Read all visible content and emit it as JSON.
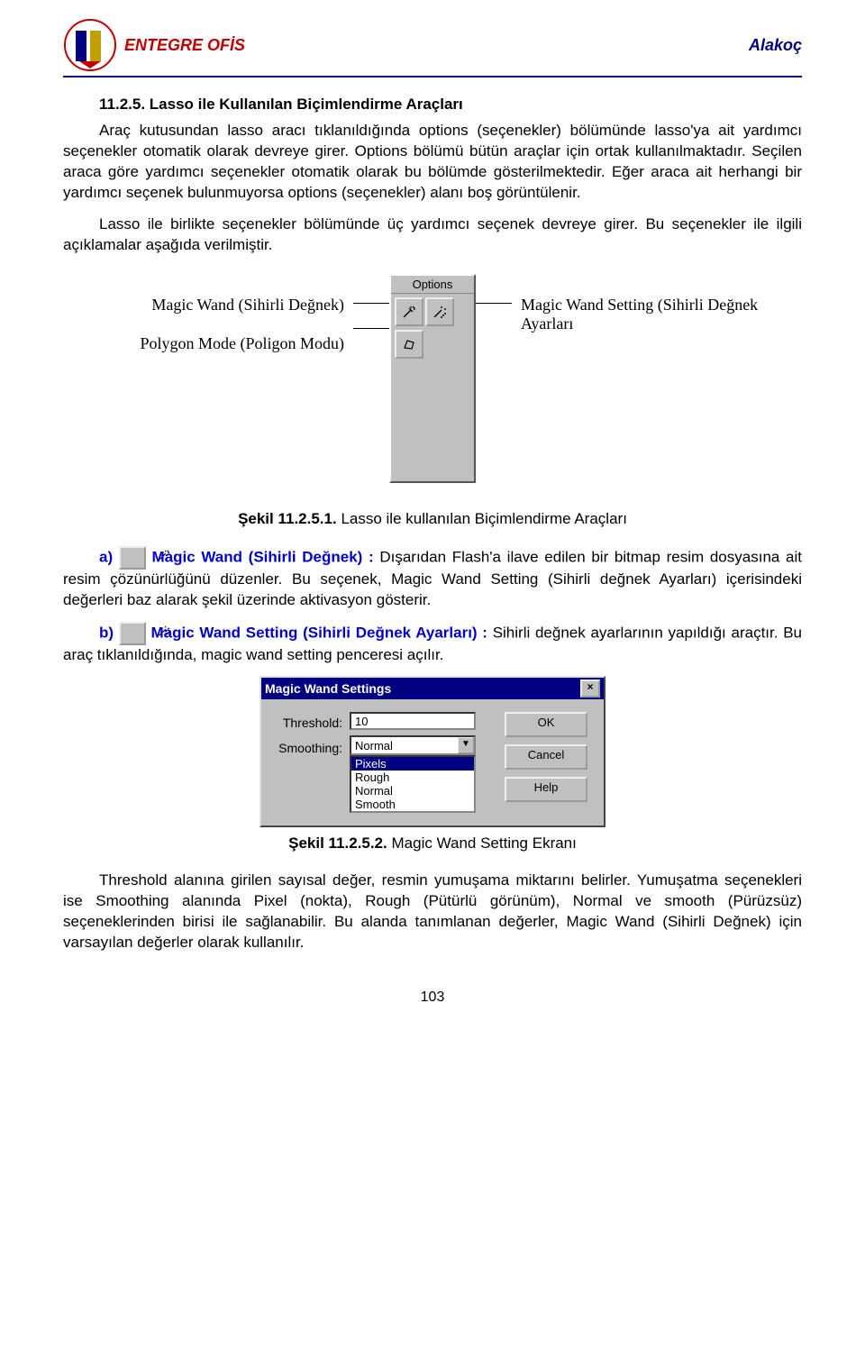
{
  "header": {
    "left_title": "ENTEGRE OFİS",
    "right_title": "Alakoç"
  },
  "section": {
    "number_title": "11.2.5.  Lasso ile Kullanılan Biçimlendirme Araçları",
    "p1": "Araç kutusundan lasso aracı tıklanıldığında options (seçenekler) bölümünde lasso'ya ait yardımcı seçenekler otomatik olarak devreye girer. Options bölümü bütün araçlar için ortak kullanılmaktadır. Seçilen araca  göre yardımcı seçenekler otomatik olarak bu bölümde gösterilmektedir. Eğer araca ait herhangi bir yardımcı seçenek bulunmuyorsa options (seçenekler) alanı boş görüntülenir.",
    "p2": "Lasso ile birlikte seçenekler bölümünde üç yardımcı seçenek devreye girer. Bu seçenekler ile ilgili açıklamalar aşağıda verilmiştir."
  },
  "diagram": {
    "left1": "Magic Wand (Sihirli Değnek)",
    "left2": "Polygon Mode (Poligon Modu)",
    "right1": "Magic Wand Setting (Sihirli Değnek Ayarları",
    "options_label": "Options"
  },
  "fig1": {
    "bold": "Şekil 11.2.5.1.",
    "rest": "  Lasso ile kullanılan Biçimlendirme Araçları"
  },
  "item_a": {
    "prefix": "a)",
    "title": "Magic Wand (Sihirli Değnek) :",
    "text": " Dışarıdan Flash'a ilave edilen bir  bitmap resim dosyasına ait resim çözünürlüğünü düzenler. Bu seçenek, Magic Wand Setting (Sihirli değnek Ayarları) içerisindeki değerleri baz alarak şekil üzerinde aktivasyon gösterir."
  },
  "item_b": {
    "prefix": "b)",
    "title": "Magic Wand Setting (Sihirli Değnek Ayarları) :",
    "text": " Sihirli değnek ayarlarının yapıldığı araçtır. Bu araç tıklanıldığında, magic wand setting penceresi açılır."
  },
  "dialog": {
    "title": "Magic Wand Settings",
    "threshold_label": "Threshold:",
    "threshold_value": "10",
    "smoothing_label": "Smoothing:",
    "smoothing_value": "Normal",
    "options": [
      "Pixels",
      "Rough",
      "Normal",
      "Smooth"
    ],
    "btn_ok": "OK",
    "btn_cancel": "Cancel",
    "btn_help": "Help"
  },
  "fig2": {
    "bold": "Şekil 11.2.5.2.",
    "rest": "  Magic Wand Setting Ekranı"
  },
  "p3": "Threshold alanına girilen sayısal değer, resmin yumuşama miktarını belirler. Yumuşatma seçenekleri ise Smoothing alanında Pixel (nokta), Rough (Pütürlü görünüm),  Normal ve smooth (Pürüzsüz)  seçeneklerinden birisi ile sağlanabilir. Bu alanda tanımlanan değerler, Magic Wand (Sihirli Değnek) için varsayılan değerler olarak kullanılır.",
  "page_number": "103"
}
